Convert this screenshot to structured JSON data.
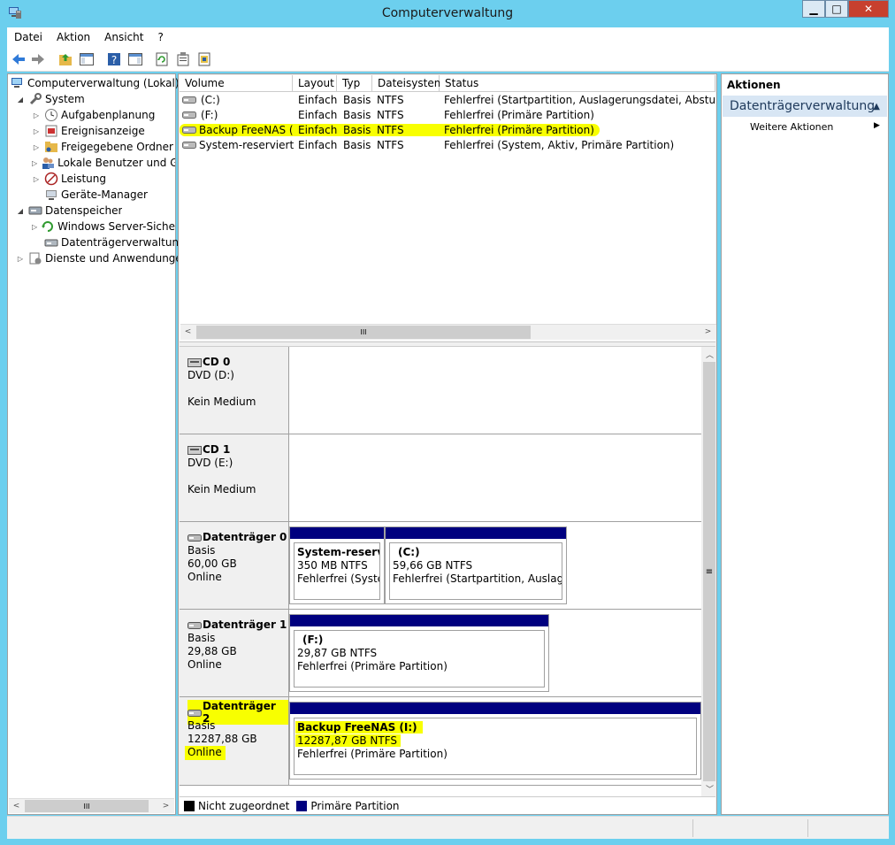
{
  "window": {
    "title": "Computerverwaltung",
    "min_label": "▁",
    "max_label": "□",
    "close_label": "✕"
  },
  "menu": [
    "Datei",
    "Aktion",
    "Ansicht",
    "?"
  ],
  "toolbar": [
    "back-icon",
    "forward-icon",
    "up-folder-icon",
    "show-hide-tree-icon",
    "help-icon",
    "show-hide-action-pane-icon",
    "refresh-icon",
    "properties-icon",
    "export-icon"
  ],
  "tree": {
    "items": [
      {
        "label": "Computerverwaltung (Lokal)",
        "icon": "computer-management-icon"
      },
      {
        "label": "System",
        "icon": "system-tools-icon"
      },
      {
        "label": "Aufgabenplanung",
        "icon": "clock-icon"
      },
      {
        "label": "Ereignisanzeige",
        "icon": "event-viewer-icon"
      },
      {
        "label": "Freigegebene Ordner",
        "icon": "shared-folder-icon"
      },
      {
        "label": "Lokale Benutzer und Gruppen",
        "icon": "users-icon"
      },
      {
        "label": "Leistung",
        "icon": "performance-icon"
      },
      {
        "label": "Geräte-Manager",
        "icon": "device-manager-icon"
      },
      {
        "label": "Datenspeicher",
        "icon": "storage-icon"
      },
      {
        "label": "Windows Server-Sicherung",
        "icon": "backup-icon"
      },
      {
        "label": "Datenträgerverwaltung",
        "icon": "disk-management-icon"
      },
      {
        "label": "Dienste und Anwendungen",
        "icon": "services-icon"
      }
    ],
    "hscroll_thumb": "III"
  },
  "volumes": {
    "columns": [
      "Volume",
      "Layout",
      "Typ",
      "Dateisystem",
      "Status"
    ],
    "rows": [
      {
        "volume": "(C:)",
        "layout": "Einfach",
        "typ": "Basis",
        "fs": "NTFS",
        "status": "Fehlerfrei (Startpartition, Auslagerungsdatei, Absturzabbild"
      },
      {
        "volume": "(F:)",
        "layout": "Einfach",
        "typ": "Basis",
        "fs": "NTFS",
        "status": "Fehlerfrei (Primäre Partition)"
      },
      {
        "volume": "Backup FreeNAS (I:)",
        "layout": "Einfach",
        "typ": "Basis",
        "fs": "NTFS",
        "status": "Fehlerfrei (Primäre Partition)"
      },
      {
        "volume": "System-reserviert",
        "layout": "Einfach",
        "typ": "Basis",
        "fs": "NTFS",
        "status": "Fehlerfrei (System, Aktiv, Primäre Partition)"
      }
    ],
    "hscroll_thumb": "III"
  },
  "disks": [
    {
      "name": "CD 0",
      "line1": "DVD (D:)",
      "line2": "",
      "line3": "Kein Medium"
    },
    {
      "name": "CD 1",
      "line1": "DVD (E:)",
      "line2": "",
      "line3": "Kein Medium"
    },
    {
      "name": "Datenträger 0",
      "line1": "Basis",
      "line2": "60,00 GB",
      "line3": "Online"
    },
    {
      "name": "Datenträger 1",
      "line1": "Basis",
      "line2": "29,88 GB",
      "line3": "Online"
    },
    {
      "name": "Datenträger 2",
      "line1": "Basis",
      "line2": "12287,88 GB",
      "line3": "Online"
    }
  ],
  "partitions": {
    "d0p1": {
      "name": "System-reservie",
      "size": "350 MB NTFS",
      "status": "Fehlerfrei (System"
    },
    "d0p2": {
      "name": "(C:)",
      "size": "59,66 GB NTFS",
      "status": "Fehlerfrei (Startpartition, Auslagerur"
    },
    "d1p1": {
      "name": "(F:)",
      "size": "29,87 GB NTFS",
      "status": "Fehlerfrei (Primäre Partition)"
    },
    "d2p1": {
      "name": "Backup FreeNAS  (I:)",
      "size": "12287,87 GB NTFS",
      "status": "Fehlerfrei (Primäre Partition)"
    }
  },
  "legend": {
    "unallocated": "Nicht zugeordnet",
    "primary": "Primäre Partition",
    "unallocated_color": "#000000",
    "primary_color": "#00007f"
  },
  "actions": {
    "header": "Aktionen",
    "section": "Datenträgerverwaltung",
    "more": "Weitere Aktionen"
  },
  "colors": {
    "highlight": "#f8ff00",
    "titlebar": "#6ccfee",
    "partition_bar": "#00007f"
  }
}
